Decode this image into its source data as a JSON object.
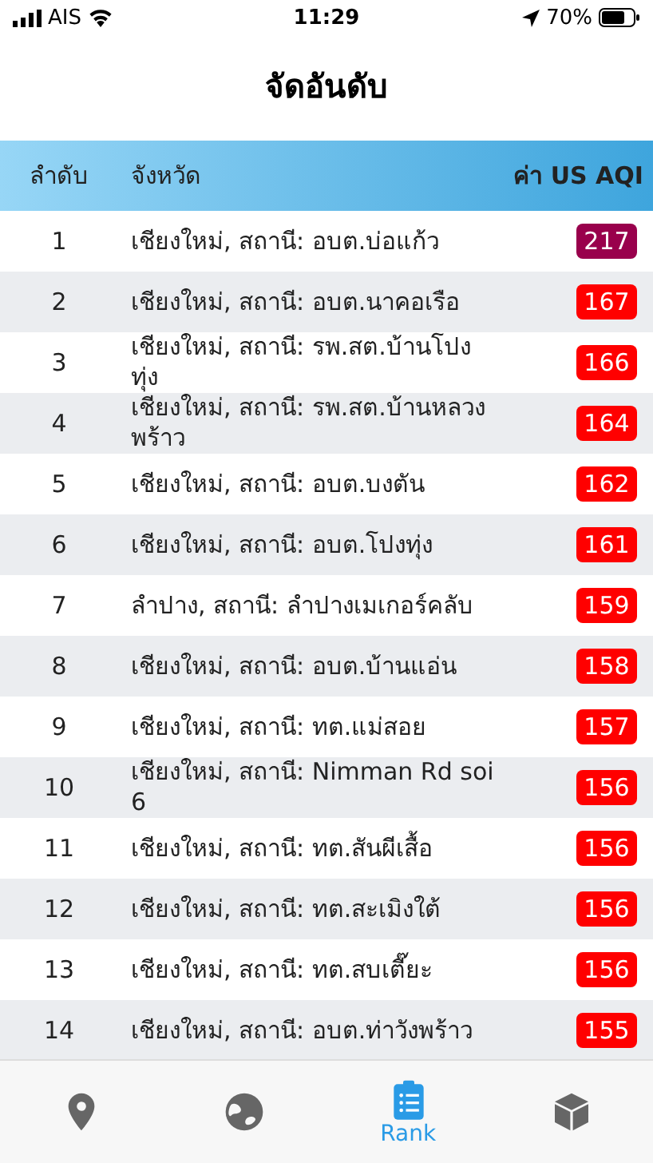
{
  "status_bar": {
    "carrier": "AIS",
    "time": "11:29",
    "battery": "70%"
  },
  "title": "จัดอันดับ",
  "table": {
    "columns": [
      "ลำดับ",
      "จังหวัด",
      "ค่า US AQI"
    ],
    "rows": [
      {
        "rank": "1",
        "name": "เชียงใหม่, สถานี: อบต.บ่อแก้ว",
        "aqi": "217",
        "color": "#99004c"
      },
      {
        "rank": "2",
        "name": "เชียงใหม่, สถานี: อบต.นาคอเรือ",
        "aqi": "167",
        "color": "#ff0000"
      },
      {
        "rank": "3",
        "name": "เชียงใหม่, สถานี: รพ.สต.บ้านโปงทุ่ง",
        "aqi": "166",
        "color": "#ff0000"
      },
      {
        "rank": "4",
        "name": "เชียงใหม่, สถานี: รพ.สต.บ้านหลวงพร้าว",
        "aqi": "164",
        "color": "#ff0000"
      },
      {
        "rank": "5",
        "name": "เชียงใหม่, สถานี: อบต.บงตัน",
        "aqi": "162",
        "color": "#ff0000"
      },
      {
        "rank": "6",
        "name": "เชียงใหม่, สถานี: อบต.โปงทุ่ง",
        "aqi": "161",
        "color": "#ff0000"
      },
      {
        "rank": "7",
        "name": "ลำปาง, สถานี: ลำปางเมเกอร์คลับ",
        "aqi": "159",
        "color": "#ff0000"
      },
      {
        "rank": "8",
        "name": "เชียงใหม่, สถานี: อบต.บ้านแอ่น",
        "aqi": "158",
        "color": "#ff0000"
      },
      {
        "rank": "9",
        "name": "เชียงใหม่, สถานี: ทต.แม่สอย",
        "aqi": "157",
        "color": "#ff0000"
      },
      {
        "rank": "10",
        "name": "เชียงใหม่, สถานี: Nimman Rd soi 6",
        "aqi": "156",
        "color": "#ff0000"
      },
      {
        "rank": "11",
        "name": "เชียงใหม่, สถานี: ทต.สันผีเสื้อ",
        "aqi": "156",
        "color": "#ff0000"
      },
      {
        "rank": "12",
        "name": "เชียงใหม่, สถานี: ทต.สะเมิงใต้",
        "aqi": "156",
        "color": "#ff0000"
      },
      {
        "rank": "13",
        "name": "เชียงใหม่, สถานี: ทต.สบเตี๊ยะ",
        "aqi": "156",
        "color": "#ff0000"
      },
      {
        "rank": "14",
        "name": "เชียงใหม่, สถานี: อบต.ท่าวังพร้าว",
        "aqi": "155",
        "color": "#ff0000"
      }
    ]
  },
  "tab_bar": [
    {
      "kind": "pin",
      "selected": false
    },
    {
      "kind": "globe",
      "selected": false
    },
    {
      "kind": "clipboard",
      "label": "Rank",
      "selected": true
    },
    {
      "kind": "cube",
      "selected": false
    }
  ]
}
